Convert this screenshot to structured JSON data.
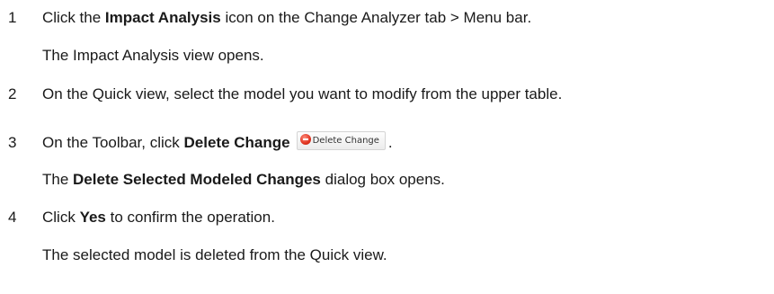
{
  "steps": [
    {
      "number": "1",
      "parts": [
        "Click the ",
        "Impact Analysis",
        " icon on the Change Analyzer tab > Menu bar."
      ],
      "result": "The Impact Analysis view opens."
    },
    {
      "number": "2",
      "text": "On the Quick view, select the model you want to modify from the upper table."
    },
    {
      "number": "3",
      "parts": [
        "On the Toolbar, click ",
        "Delete Change",
        "."
      ],
      "button_label": "Delete Change",
      "button_icon": "minus-circle-icon",
      "result_parts": [
        "The ",
        "Delete Selected Modeled Changes",
        " dialog box opens."
      ]
    },
    {
      "number": "4",
      "parts": [
        "Click ",
        "Yes",
        " to confirm the operation."
      ],
      "result": "The selected model is deleted from the Quick view."
    }
  ]
}
